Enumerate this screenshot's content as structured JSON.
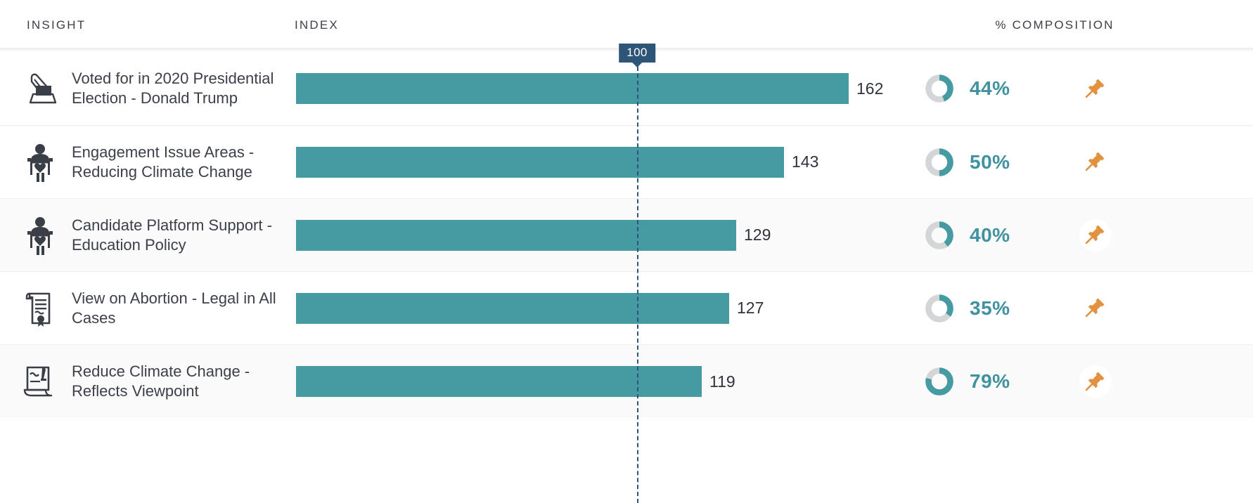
{
  "header": {
    "insight_label": "INSIGHT",
    "index_label": "INDEX",
    "composition_label": "% COMPOSITION"
  },
  "index_marker": {
    "value": "100",
    "badge_color": "#2d5578",
    "line_style": "dashed"
  },
  "colors": {
    "bar": "#469ba2",
    "donut_fill": "#469ba2",
    "donut_track": "#d4d5d6",
    "percent_text": "#3f93a0",
    "pin": "#e2913f",
    "marker": "#2d5578",
    "text": "#3c4049"
  },
  "chart_data": {
    "type": "bar",
    "title": "",
    "xlabel": "INDEX",
    "ylabel": "INSIGHT",
    "reference_line": 100,
    "xlim": [
      0,
      200
    ],
    "grid": false,
    "categories": [
      "Voted for in 2020 Presidential Election - Donald Trump",
      "Engagement Issue Areas - Reducing Climate Change",
      "Candidate Platform Support - Education Policy",
      "View on Abortion - Legal in All Cases",
      "Reduce Climate Change - Reflects Viewpoint"
    ],
    "values": [
      162,
      143,
      129,
      127,
      119
    ],
    "composition_percent": [
      44,
      50,
      40,
      35,
      79
    ]
  },
  "rows": [
    {
      "icon": "ballot-box-icon",
      "label": "Voted for in 2020 Presidential Election - Donald Trump",
      "index": "162",
      "index_value": 162,
      "percent": "44%",
      "percent_value": 44,
      "pin": "pin-icon",
      "shade": false
    },
    {
      "icon": "activist-sign-heart-icon",
      "label": "Engagement Issue Areas - Reducing Climate Change",
      "index": "143",
      "index_value": 143,
      "percent": "50%",
      "percent_value": 50,
      "pin": "pin-icon",
      "shade": false
    },
    {
      "icon": "activist-sign-heart-icon",
      "label": "Candidate Platform Support - Education Policy",
      "index": "129",
      "index_value": 129,
      "percent": "40%",
      "percent_value": 40,
      "pin": "pin-icon",
      "shade": true
    },
    {
      "icon": "document-scroll-icon",
      "label": "View on Abortion - Legal in All Cases",
      "index": "127",
      "index_value": 127,
      "percent": "35%",
      "percent_value": 35,
      "pin": "pin-icon",
      "shade": false
    },
    {
      "icon": "signed-document-icon",
      "label": "Reduce Climate Change - Reflects Viewpoint",
      "index": "119",
      "index_value": 119,
      "percent": "79%",
      "percent_value": 79,
      "pin": "pin-icon",
      "shade": true
    }
  ]
}
